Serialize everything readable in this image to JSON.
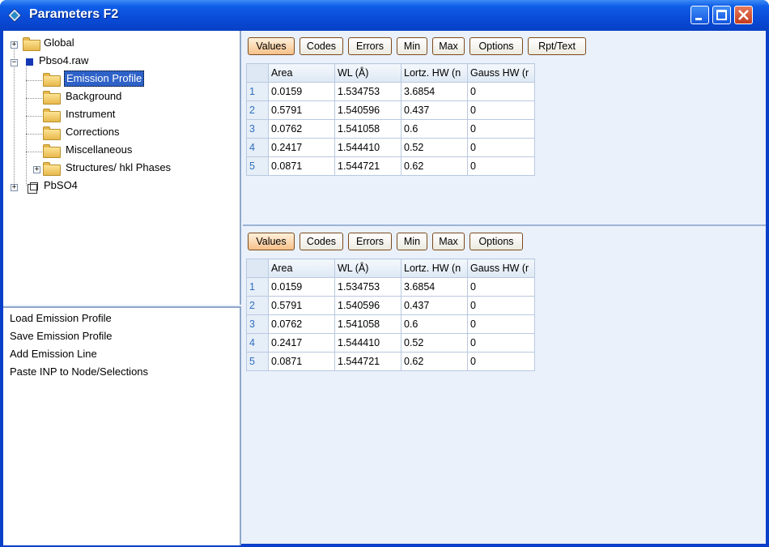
{
  "window": {
    "title": "Parameters F2"
  },
  "tree": {
    "items": [
      {
        "label": "Global"
      },
      {
        "label": "Pbso4.raw"
      },
      {
        "label": "Emission Profile"
      },
      {
        "label": "Background"
      },
      {
        "label": "Instrument"
      },
      {
        "label": "Corrections"
      },
      {
        "label": "Miscellaneous"
      },
      {
        "label": "Structures/ hkl Phases"
      },
      {
        "label": "PbSO4"
      }
    ]
  },
  "actions": [
    {
      "label": "Load Emission Profile"
    },
    {
      "label": "Save Emission Profile"
    },
    {
      "label": "Add Emission Line"
    },
    {
      "label": "Paste INP to Node/Selections"
    }
  ],
  "top_panel": {
    "buttons": [
      "Values",
      "Codes",
      "Errors",
      "Min",
      "Max",
      "Options",
      "Rpt/Text"
    ],
    "headers": [
      "Area",
      "WL (Å)",
      "Lortz. HW (n",
      "Gauss HW (r"
    ],
    "rows": [
      {
        "idx": "1",
        "cells": [
          "0.0159",
          "1.534753",
          "3.6854",
          "0"
        ]
      },
      {
        "idx": "2",
        "cells": [
          "0.5791",
          "1.540596",
          "0.437",
          "0"
        ]
      },
      {
        "idx": "3",
        "cells": [
          "0.0762",
          "1.541058",
          "0.6",
          "0"
        ]
      },
      {
        "idx": "4",
        "cells": [
          "0.2417",
          "1.544410",
          "0.52",
          "0"
        ]
      },
      {
        "idx": "5",
        "cells": [
          "0.0871",
          "1.544721",
          "0.62",
          "0"
        ]
      }
    ]
  },
  "bottom_panel": {
    "buttons": [
      "Values",
      "Codes",
      "Errors",
      "Min",
      "Max",
      "Options"
    ],
    "headers": [
      "Area",
      "WL (Å)",
      "Lortz. HW (n",
      "Gauss HW (r"
    ],
    "rows": [
      {
        "idx": "1",
        "cells": [
          "0.0159",
          "1.534753",
          "3.6854",
          "0"
        ]
      },
      {
        "idx": "2",
        "cells": [
          "0.5791",
          "1.540596",
          "0.437",
          "0"
        ]
      },
      {
        "idx": "3",
        "cells": [
          "0.0762",
          "1.541058",
          "0.6",
          "0"
        ]
      },
      {
        "idx": "4",
        "cells": [
          "0.2417",
          "1.544410",
          "0.52",
          "0"
        ]
      },
      {
        "idx": "5",
        "cells": [
          "0.0871",
          "1.544721",
          "0.62",
          "0"
        ]
      }
    ]
  },
  "colors": {
    "titlebar": "#0a4bd8",
    "selected": "#2e62c8",
    "active_button": "#f7c08a"
  }
}
